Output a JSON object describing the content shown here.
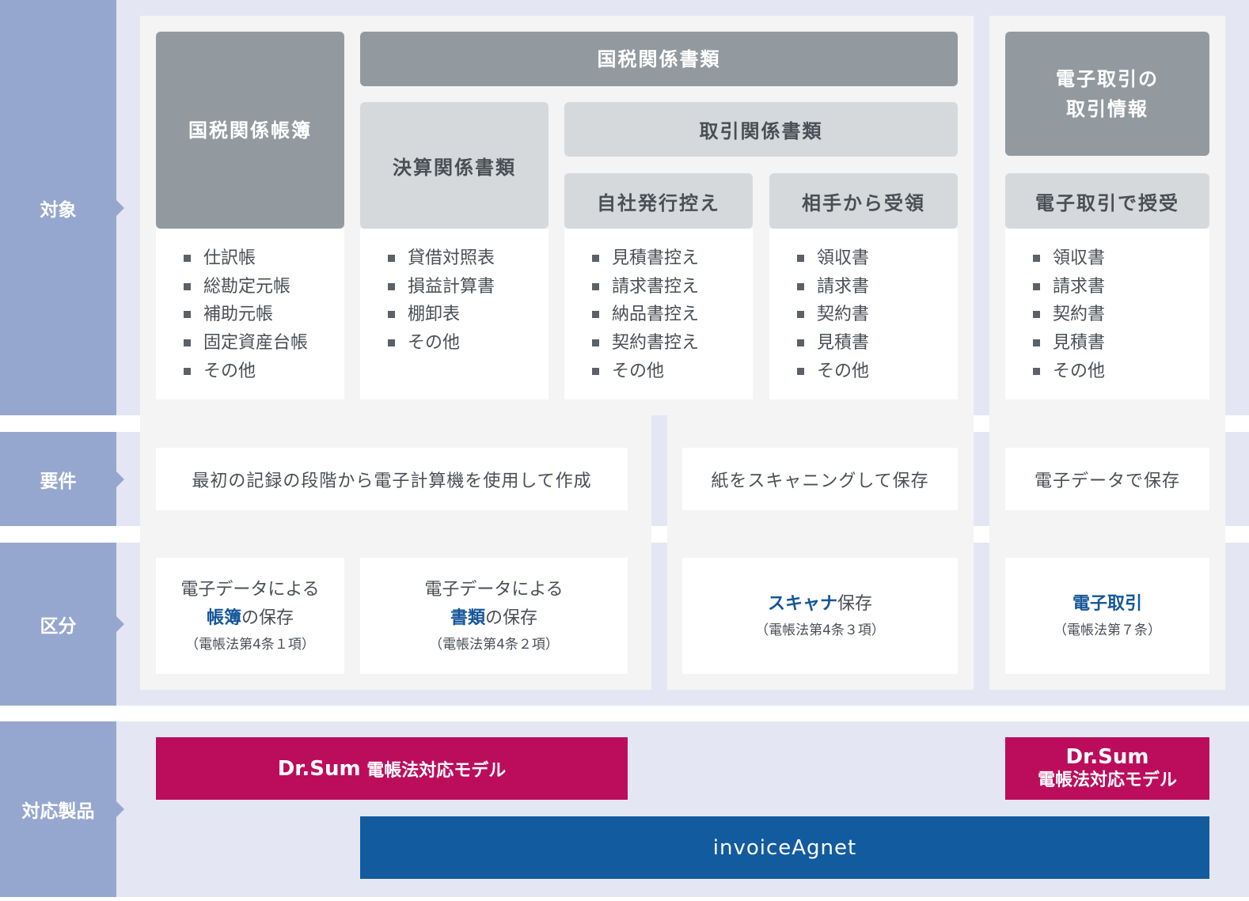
{
  "rows": {
    "target": "対象",
    "requirement": "要件",
    "category": "区分",
    "products": "対応製品"
  },
  "targets": {
    "kokuzei_kankei_shorui": "国税関係書類",
    "kokuzei_kankei_chobo": "国税関係帳簿",
    "kessan_kankei_shorui": "決算関係書類",
    "torihiki_kankei_shorui": "取引関係書類",
    "jisha_hakko": "自社発行控え",
    "aite_juryo": "相手から受領",
    "denshi_torihiki_joho": "電子取引の\n取引情報",
    "denshi_torihiki_juju": "電子取引で授受"
  },
  "lists": {
    "chobo": [
      "仕訳帳",
      "総勘定元帳",
      "補助元帳",
      "固定資産台帳",
      "その他"
    ],
    "kessan": [
      "貸借対照表",
      "損益計算書",
      "棚卸表",
      "その他"
    ],
    "jisha": [
      "見積書控え",
      "請求書控え",
      "納品書控え",
      "契約書控え",
      "その他"
    ],
    "aite": [
      "領収書",
      "請求書",
      "契約書",
      "見積書",
      "その他"
    ],
    "denshi": [
      "領収書",
      "請求書",
      "契約書",
      "見積書",
      "その他"
    ]
  },
  "requirements": {
    "electronic_creation": "最初の記録の段階から電子計算機を使用して作成",
    "scanning": "紙をスキャニングして保存",
    "electronic_data": "電子データで保存"
  },
  "categories": {
    "chobo": {
      "prefix": "電子データによる",
      "highlight": "帳簿",
      "suffix": "の保存",
      "law": "（電帳法第4条１項）"
    },
    "shorui": {
      "prefix": "電子データによる",
      "highlight": "書類",
      "suffix": "の保存",
      "law": "（電帳法第4条２項）"
    },
    "scanner": {
      "highlight": "スキャナ",
      "suffix": "保存",
      "law": "（電帳法第4条３項）"
    },
    "denshi": {
      "highlight": "電子取引",
      "law": "（電帳法第７条）"
    }
  },
  "products": {
    "drsum_wide": {
      "main": "Dr.Sum",
      "sub": " 電帳法対応モデル"
    },
    "drsum_right": {
      "main": "Dr.Sum",
      "sub": "電帳法対応モデル"
    },
    "invoice_agnet": "invoiceAgnet"
  },
  "colors": {
    "row_label": "#96a7cf",
    "band": "#e4e7f3",
    "header_dark": "#939a9f",
    "header_light": "#d6d9dc",
    "highlight_text": "#15569a",
    "product_crimson": "#bc0d5c",
    "product_blue": "#125b9f"
  }
}
